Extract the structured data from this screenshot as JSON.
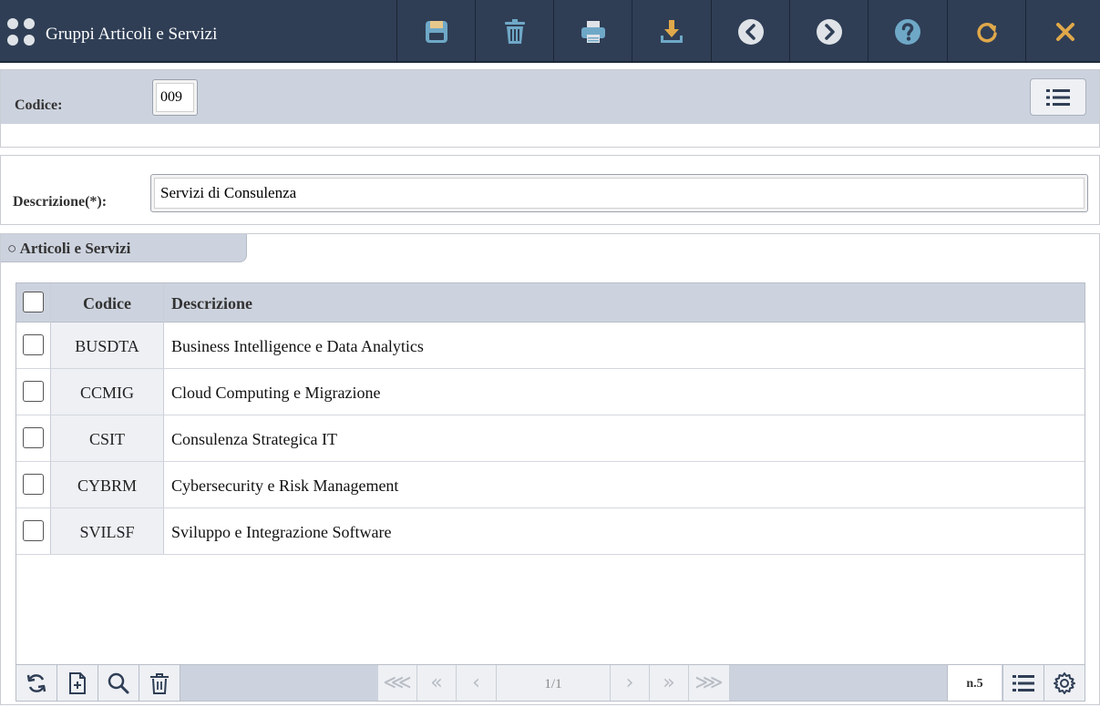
{
  "header": {
    "title": "Gruppi Articoli e Servizi",
    "app_icon": "dots-grid-icon",
    "toolbar": [
      {
        "name": "save-button",
        "icon": "save-icon",
        "color": "#6fa8c7"
      },
      {
        "name": "delete-button",
        "icon": "trash-icon",
        "color": "#6fa8c7"
      },
      {
        "name": "print-button",
        "icon": "printer-icon",
        "color": "#6fa8c7"
      },
      {
        "name": "download-button",
        "icon": "download-icon",
        "color": "#e0a84a"
      },
      {
        "name": "previous-button",
        "icon": "chevron-left-circle-icon",
        "color": "#dfe3e8"
      },
      {
        "name": "next-button",
        "icon": "chevron-right-circle-icon",
        "color": "#dfe3e8"
      },
      {
        "name": "help-button",
        "icon": "question-circle-icon",
        "color": "#6fa8c7"
      },
      {
        "name": "refresh-button",
        "icon": "redo-icon",
        "color": "#e0a84a"
      },
      {
        "name": "close-button",
        "icon": "close-icon",
        "color": "#e0a84a"
      }
    ]
  },
  "code_panel": {
    "label": "Codice:",
    "value": "009"
  },
  "desc_panel": {
    "label": "Descrizione(*):",
    "value": "Servizi di Consulenza"
  },
  "section": {
    "title": "○ Articoli e Servizi",
    "columns": {
      "code": "Codice",
      "description": "Descrizione"
    },
    "rows": [
      {
        "code": "BUSDTA",
        "description": "Business Intelligence e Data Analytics"
      },
      {
        "code": "CCMIG",
        "description": "Cloud Computing e Migrazione"
      },
      {
        "code": "CSIT",
        "description": "Consulenza Strategica IT"
      },
      {
        "code": "CYBRM",
        "description": "Cybersecurity e Risk Management"
      },
      {
        "code": "SVILSF",
        "description": "Sviluppo e Integrazione Software"
      }
    ],
    "footer": {
      "page": "1/1",
      "count": "n.5",
      "pager": {
        "first": "⋘",
        "prev_block": "«",
        "prev": "‹",
        "next": "›",
        "next_block": "»",
        "last": "⋙"
      }
    }
  },
  "colors": {
    "topbar": "#2f3e55",
    "band": "#cdd3de",
    "accent_blue": "#6fa8c7",
    "accent_orange": "#e0a84a"
  }
}
